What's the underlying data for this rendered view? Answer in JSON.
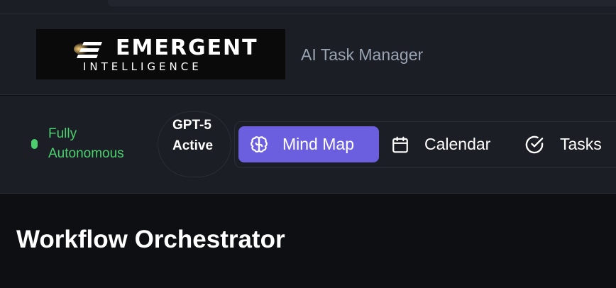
{
  "header": {
    "logo": {
      "line1": "EMERGENT",
      "line2": "INTELLIGENCE"
    },
    "subtitle": "AI Task Manager"
  },
  "status": {
    "label": "Fully Autonomous",
    "color": "#4ccf6e"
  },
  "model": {
    "label": "GPT-5 Active"
  },
  "nav": {
    "accent": "#6b5fe0",
    "items": [
      {
        "label": "Mind Map",
        "icon": "brain-icon",
        "active": true
      },
      {
        "label": "Calendar",
        "icon": "calendar-icon",
        "active": false
      },
      {
        "label": "Tasks",
        "icon": "check-circle-icon",
        "active": false
      }
    ]
  },
  "main": {
    "title": "Workflow Orchestrator"
  }
}
